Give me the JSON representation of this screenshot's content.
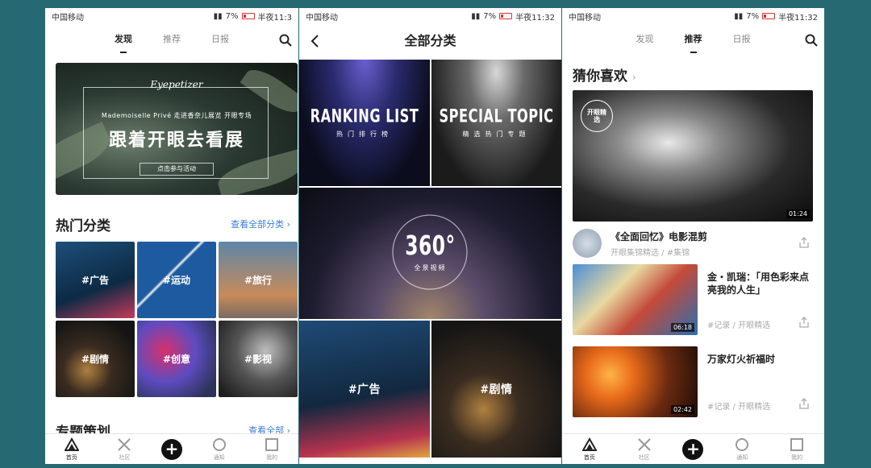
{
  "status": {
    "carrier": "中国移动",
    "battery": "7%",
    "time_left": "半夜11:3",
    "time": "半夜11:32"
  },
  "nav": {
    "tabs": [
      "发现",
      "推荐",
      "日报"
    ]
  },
  "discover": {
    "banner": {
      "brand": "Eyepetizer",
      "subtitle": "Mademoiselle Privé 走进香奈儿展览 开眼专场",
      "headline": "跟着开眼去看展",
      "cta": "点击参与活动"
    },
    "hot_title": "热门分类",
    "hot_link": "查看全部分类",
    "categories": [
      "#广告",
      "#运动",
      "#旅行",
      "#剧情",
      "#创意",
      "#影视"
    ],
    "topic_title": "专题策划",
    "topic_link": "查看全部"
  },
  "all_categories": {
    "title": "全部分类",
    "tiles": [
      {
        "big": "RANKING LIST",
        "small": "热门排行榜"
      },
      {
        "big": "SPECIAL TOPIC",
        "small": "精选热门专题"
      },
      {
        "big": "360°",
        "small": "全景视频"
      },
      {
        "big": "#广告",
        "small": ""
      },
      {
        "big": "#剧情",
        "small": ""
      }
    ]
  },
  "recommend": {
    "title": "猜你喜欢",
    "badge": "开眼精选",
    "videos": [
      {
        "title": "《全面回忆》电影混剪",
        "meta": "开眼集锦精选 / #集锦",
        "duration": "01:24"
      },
      {
        "title": "金・凯瑞：「用色彩来点亮我的人生」",
        "meta": "#记录 / 开眼精选",
        "duration": "06:18"
      },
      {
        "title": "万家灯火祈福时",
        "meta": "#记录 / 开眼精选",
        "duration": "02:42"
      }
    ]
  },
  "bottom_nav": [
    "首页",
    "社区",
    "通知",
    "我的"
  ]
}
